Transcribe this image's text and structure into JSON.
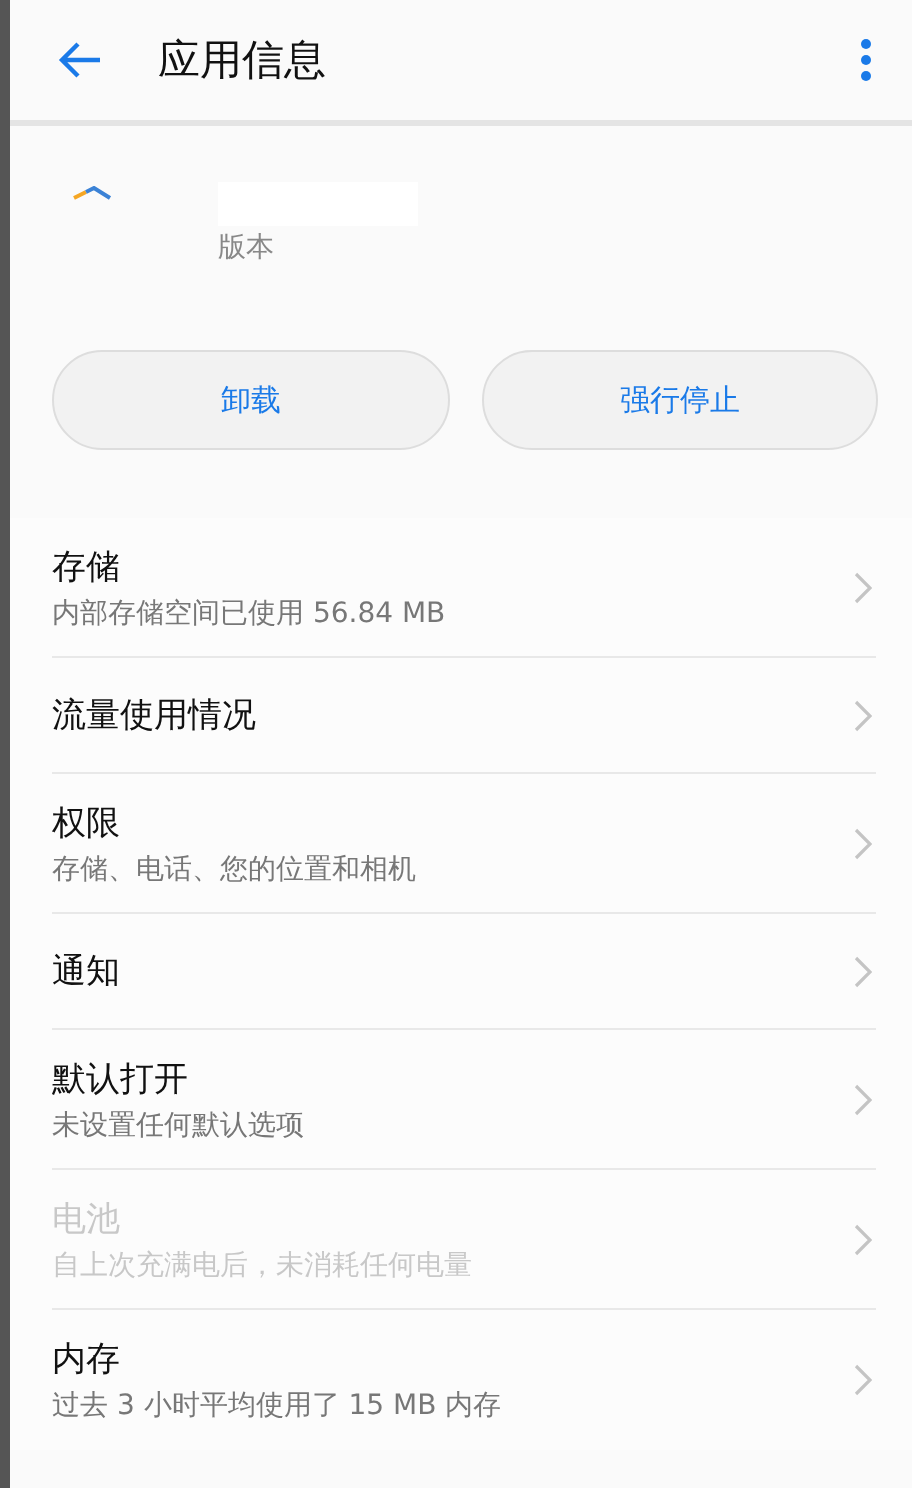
{
  "header": {
    "title": "应用信息"
  },
  "app": {
    "version_label": "版本"
  },
  "buttons": [
    {
      "label": "卸载"
    },
    {
      "label": "强行停止"
    }
  ],
  "items": [
    {
      "title": "存储",
      "subtitle": "内部存储空间已使用 56.84 MB",
      "disabled": false
    },
    {
      "title": "流量使用情况",
      "disabled": false
    },
    {
      "title": "权限",
      "subtitle": "存储、电话、您的位置和相机",
      "disabled": false
    },
    {
      "title": "通知",
      "disabled": false
    },
    {
      "title": "默认打开",
      "subtitle": "未设置任何默认选项",
      "disabled": false
    },
    {
      "title": "电池",
      "subtitle": "自上次充满电后，未消耗任何电量",
      "disabled": true
    },
    {
      "title": "内存",
      "subtitle": "过去 3 小时平均使用了 15 MB 内存",
      "disabled": false
    }
  ]
}
